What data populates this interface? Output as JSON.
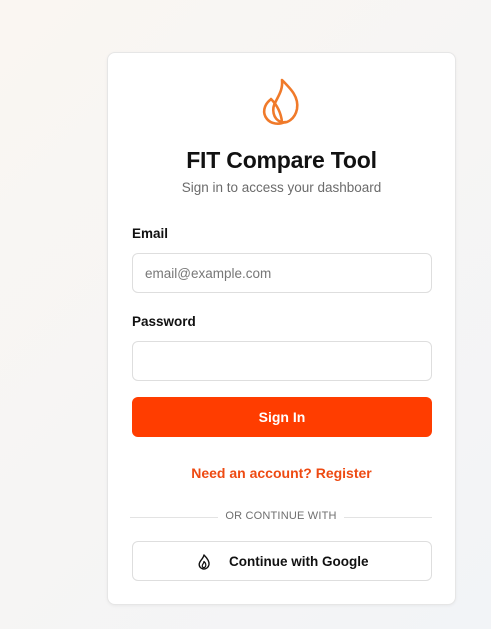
{
  "app": {
    "title": "FIT Compare Tool",
    "subtitle": "Sign in to access your dashboard",
    "logo_icon": "flame-leaf-icon",
    "accent_color": "#ff3d00",
    "logo_color": "#f07a2a"
  },
  "form": {
    "email_label": "Email",
    "email_placeholder": "email@example.com",
    "email_value": "",
    "password_label": "Password",
    "password_value": "",
    "signin_label": "Sign In",
    "register_link": "Need an account? Register"
  },
  "divider": {
    "text": "OR CONTINUE WITH"
  },
  "google": {
    "label": "Continue with Google",
    "icon": "flame-icon"
  }
}
